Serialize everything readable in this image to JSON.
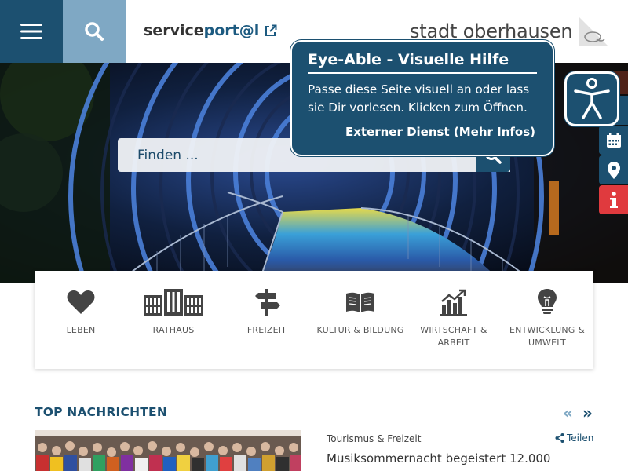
{
  "header": {
    "service_bold": "service",
    "service_accent": "port@l",
    "city_name": "stadt oberhausen"
  },
  "search": {
    "placeholder": "Finden ..."
  },
  "eye_able": {
    "title": "Eye-Able - Visuelle Hilfe",
    "text": "Passe diese Seite visuell an oder lass sie Dir vorlesen. Klicken zum Öffnen.",
    "external": "Externer Dienst (",
    "more_info": "Mehr Infos",
    "close_paren": ")"
  },
  "side_buttons": [
    {
      "icon": "calendar-icon",
      "color": "#1c5070"
    },
    {
      "icon": "location-pin-icon",
      "color": "#1c5070"
    },
    {
      "icon": "info-icon",
      "color": "#e03a3e"
    }
  ],
  "categories": [
    {
      "label": "LEBEN",
      "icon": "heart-icon"
    },
    {
      "label": "RATHAUS",
      "icon": "town-hall-icon"
    },
    {
      "label": "FREIZEIT",
      "icon": "signpost-icon"
    },
    {
      "label": "KULTUR & BILDUNG",
      "icon": "book-icon"
    },
    {
      "label": "WIRTSCHAFT & ARBEIT",
      "icon": "chart-icon"
    },
    {
      "label": "ENTWICKLUNG & UMWELT",
      "icon": "lightbulb-icon"
    }
  ],
  "news": {
    "section_title": "TOP NACHRICHTEN",
    "prev": "«",
    "next": "»",
    "item": {
      "category": "Tourismus & Freizeit",
      "share_label": "Teilen",
      "headline": "Musiksommernacht begeistert 12.000"
    }
  },
  "colors": {
    "brand_dark": "#1c5070",
    "brand_light": "#7fa8c4",
    "info_red": "#e03a3e"
  }
}
